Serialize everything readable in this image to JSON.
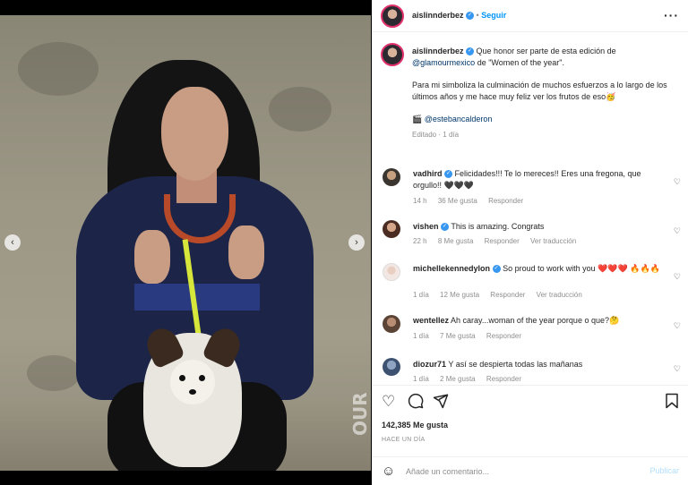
{
  "post": {
    "username": "aislinnderbez",
    "follow_label": "Seguir",
    "more_icon": "ellipsis-icon"
  },
  "caption": {
    "username": "aislinnderbez",
    "line1_text": "Que honor ser parte de esta edición de",
    "mention_glamour": "@glamourmexico",
    "line2_text": "de \"Women of the year\".",
    "para2": "Para mi simboliza la culminación de muchos esfuerzos a lo largo de los últimos años y me hace muy feliz ver los frutos de eso🥳",
    "credit_icon": "🎬",
    "credit_mention": "@estebancalderon",
    "edited": "Editado",
    "time": "1 día"
  },
  "comments": [
    {
      "username": "vadhird",
      "verified": true,
      "text": "Felicidades!!! Te lo mereces!! Eres una fregona, que orgullo!! 🖤🖤🖤",
      "time": "14 h",
      "likes": "36 Me gusta",
      "reply": "Responder",
      "translate": ""
    },
    {
      "username": "vishen",
      "verified": true,
      "text": "This is amazing. Congrats",
      "time": "22 h",
      "likes": "8 Me gusta",
      "reply": "Responder",
      "translate": "Ver traducción"
    },
    {
      "username": "michellekennedylon",
      "verified": true,
      "text": "So proud to work with you ❤️❤️❤️ 🔥🔥🔥",
      "time": "1 día",
      "likes": "12 Me gusta",
      "reply": "Responder",
      "translate": "Ver traducción"
    },
    {
      "username": "wentellez",
      "verified": false,
      "text": "Ah caray...woman of the year porque o que?🤔",
      "time": "1 día",
      "likes": "7 Me gusta",
      "reply": "Responder",
      "translate": ""
    },
    {
      "username": "diozur71",
      "verified": false,
      "text": "Y así se despierta todas las mañanas",
      "time": "1 día",
      "likes": "2 Me gusta",
      "reply": "Responder",
      "translate": ""
    }
  ],
  "actions": {
    "likes": "142,385 Me gusta",
    "ago": "HACE UN DÍA"
  },
  "add_comment": {
    "placeholder": "Añade un comentario...",
    "publish_label": "Publicar"
  },
  "photo": {
    "watermark": "OUR",
    "prev_arrow": "‹",
    "next_arrow": "›"
  }
}
